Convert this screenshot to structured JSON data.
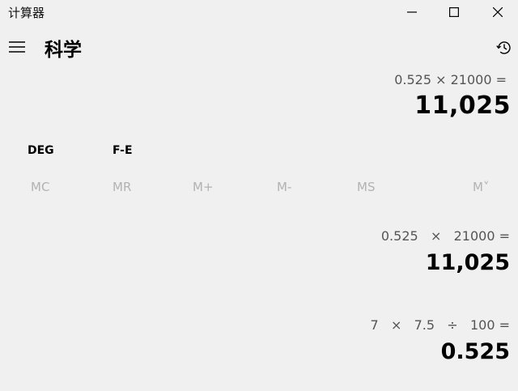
{
  "window": {
    "title": "计算器"
  },
  "header": {
    "mode": "科学"
  },
  "display": {
    "expression": "0.525 × 21000 =",
    "value": "11,025"
  },
  "modes": {
    "angle": "DEG",
    "fe": "F-E"
  },
  "memory": {
    "buttons": [
      "MC",
      "MR",
      "M+",
      "M-",
      "MS",
      "M˅"
    ]
  },
  "history": [
    {
      "expression": "0.525   ×   21000 =",
      "value": "11,025"
    },
    {
      "expression": "7   ×   7.5   ÷   100 =",
      "value": "0.525"
    }
  ],
  "icons": {
    "menu": "hamburger-icon",
    "history": "history-icon",
    "minimize": "minimize-icon",
    "maximize": "maximize-icon",
    "close": "close-icon"
  }
}
